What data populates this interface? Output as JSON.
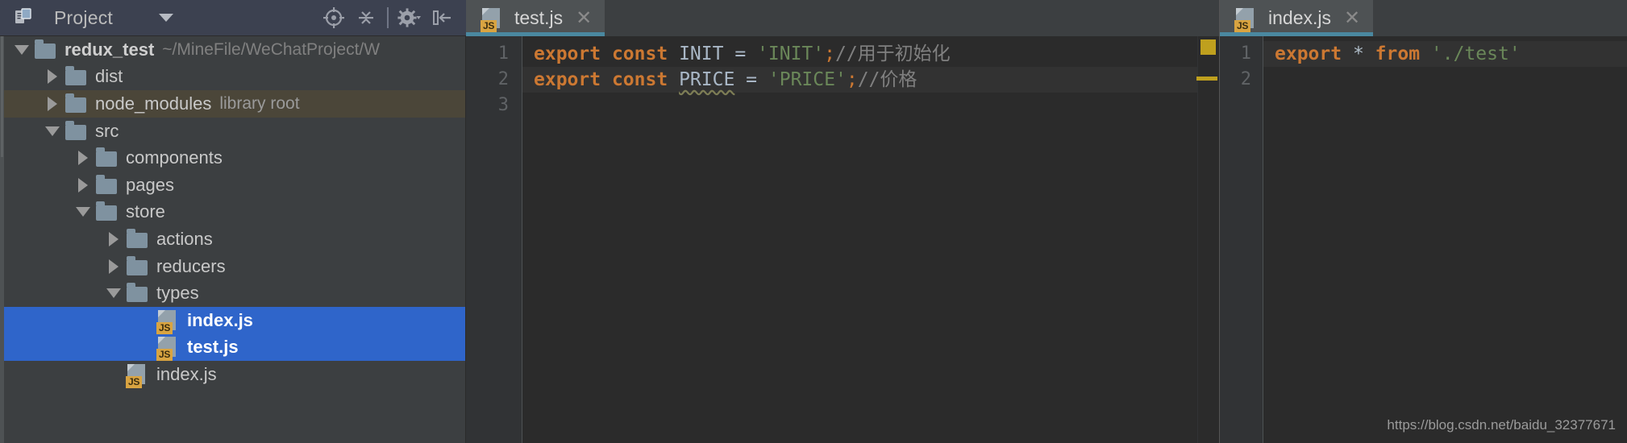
{
  "tool_window": {
    "title": "Project",
    "icon": "project-view-icon",
    "dropdown_icon": "chevron-down-icon",
    "toolbar_icons": [
      {
        "name": "locate-target-icon",
        "label": "Select Opened File"
      },
      {
        "name": "collapse-all-icon",
        "label": "Collapse All"
      },
      {
        "name": "gear-icon",
        "label": "Settings"
      },
      {
        "name": "hide-panel-icon",
        "label": "Hide"
      }
    ]
  },
  "tree": [
    {
      "label": "redux_test",
      "sub": "~/MineFile/WeChatProject/W",
      "icon": "folder-icon",
      "arrow": "down",
      "indent": 0,
      "state": "root"
    },
    {
      "label": "dist",
      "sub": "",
      "icon": "folder-icon",
      "arrow": "right",
      "indent": 1,
      "state": "normal"
    },
    {
      "label": "node_modules",
      "sub": "library root",
      "icon": "folder-icon",
      "arrow": "right",
      "indent": 1,
      "state": "library"
    },
    {
      "label": "src",
      "sub": "",
      "icon": "folder-icon",
      "arrow": "down",
      "indent": 1,
      "state": "normal"
    },
    {
      "label": "components",
      "sub": "",
      "icon": "folder-icon",
      "arrow": "right",
      "indent": 2,
      "state": "normal"
    },
    {
      "label": "pages",
      "sub": "",
      "icon": "folder-icon",
      "arrow": "right",
      "indent": 2,
      "state": "normal"
    },
    {
      "label": "store",
      "sub": "",
      "icon": "folder-icon",
      "arrow": "down",
      "indent": 2,
      "state": "normal"
    },
    {
      "label": "actions",
      "sub": "",
      "icon": "folder-icon",
      "arrow": "right",
      "indent": 3,
      "state": "normal"
    },
    {
      "label": "reducers",
      "sub": "",
      "icon": "folder-icon",
      "arrow": "right",
      "indent": 3,
      "state": "normal"
    },
    {
      "label": "types",
      "sub": "",
      "icon": "folder-icon",
      "arrow": "down",
      "indent": 3,
      "state": "normal"
    },
    {
      "label": "index.js",
      "sub": "",
      "icon": "js-file-icon",
      "arrow": "none",
      "indent": 4,
      "state": "selected"
    },
    {
      "label": "test.js",
      "sub": "",
      "icon": "js-file-icon",
      "arrow": "none",
      "indent": 4,
      "state": "selected"
    },
    {
      "label": "index.js",
      "sub": "",
      "icon": "js-file-icon",
      "arrow": "none",
      "indent": 3,
      "state": "normal"
    }
  ],
  "panes": [
    {
      "tab": {
        "label": "test.js",
        "icon": "js-file-icon",
        "close_icon": "close-icon",
        "active": true
      },
      "line_numbers": [
        "1",
        "2",
        "3"
      ],
      "lines": [
        {
          "caret": false,
          "tokens": [
            {
              "t": "export",
              "c": "kw"
            },
            {
              "t": " ",
              "c": "op"
            },
            {
              "t": "const",
              "c": "kw"
            },
            {
              "t": " ",
              "c": "op"
            },
            {
              "t": "INIT",
              "c": "ident"
            },
            {
              "t": " ",
              "c": "op"
            },
            {
              "t": "=",
              "c": "op"
            },
            {
              "t": " ",
              "c": "op"
            },
            {
              "t": "'INIT'",
              "c": "str"
            },
            {
              "t": ";",
              "c": "semi"
            },
            {
              "t": "//用于初始化",
              "c": "cmt"
            }
          ]
        },
        {
          "caret": true,
          "tokens": [
            {
              "t": "export",
              "c": "kw"
            },
            {
              "t": " ",
              "c": "op"
            },
            {
              "t": "const",
              "c": "kw"
            },
            {
              "t": " ",
              "c": "op"
            },
            {
              "t": "PRICE",
              "c": "ident-w"
            },
            {
              "t": " ",
              "c": "op"
            },
            {
              "t": "=",
              "c": "op"
            },
            {
              "t": " ",
              "c": "op"
            },
            {
              "t": "'PRICE'",
              "c": "str"
            },
            {
              "t": ";",
              "c": "semi"
            },
            {
              "t": "//价格",
              "c": "cmt"
            }
          ]
        },
        {
          "caret": false,
          "tokens": []
        }
      ],
      "markers": {
        "warning_box": "#bfa01e",
        "warning_line": "#bfa01e"
      }
    },
    {
      "tab": {
        "label": "index.js",
        "icon": "js-file-icon",
        "close_icon": "close-icon",
        "active": true
      },
      "line_numbers": [
        "1",
        "2"
      ],
      "lines": [
        {
          "caret": true,
          "tokens": [
            {
              "t": "export",
              "c": "kw"
            },
            {
              "t": " ",
              "c": "op"
            },
            {
              "t": "*",
              "c": "star"
            },
            {
              "t": " ",
              "c": "op"
            },
            {
              "t": "from",
              "c": "kw"
            },
            {
              "t": " ",
              "c": "op"
            },
            {
              "t": "'./test'",
              "c": "str"
            }
          ]
        },
        {
          "caret": false,
          "tokens": []
        }
      ]
    }
  ],
  "watermark": "https://blog.csdn.net/baidu_32377671",
  "colors": {
    "toolwindow_header": "#3c4150",
    "panel_bg": "#3c3f41",
    "editor_bg": "#2b2b2b",
    "selection_blue": "#2f65ca",
    "library_row": "#4b4639",
    "tab_active_underline": "#4a88a0",
    "keyword_orange": "#cc7832",
    "string_green": "#6a8759",
    "comment_grey": "#808080",
    "warning_yellow": "#bfa01e",
    "js_badge": "#d9a441"
  }
}
